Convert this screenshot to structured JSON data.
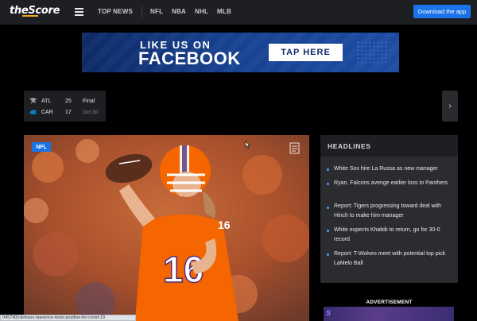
{
  "nav": {
    "logo": "theScore",
    "links": [
      "TOP NEWS",
      "NFL",
      "NBA",
      "NHL",
      "MLB"
    ],
    "download_label": "Download the app"
  },
  "banner": {
    "line1": "LIKE US ON",
    "line2": "FACEBOOK",
    "cta": "TAP HERE"
  },
  "scoreboard": {
    "teams": [
      {
        "abbr": "ATL",
        "score": "25",
        "status": "Final"
      },
      {
        "abbr": "CAR",
        "score": "17",
        "status": "Oct 30"
      }
    ]
  },
  "hero": {
    "tag": "NFL"
  },
  "headlines": {
    "title": "HEADLINES",
    "items": [
      "White Sox hire La Russa as new manager",
      "Ryan, Falcons avenge earlier loss to Panthers",
      "Report: Tigers progressing toward deal with Hinch to make him manager",
      "White expects Khabib to return, go for 30-0 record",
      "Report: T-Wolves meet with potential top pick LaMelo Ball"
    ]
  },
  "ad": {
    "label": "ADVERTISEMENT"
  },
  "statusbar": {
    "url": "045740/clemson-lawrence-tests-positive-for-covid-19"
  },
  "colors": {
    "accent": "#1a73e8",
    "logo_underline": "#f5a623",
    "panel": "#2b2c30",
    "clemson_orange": "#f56600"
  }
}
